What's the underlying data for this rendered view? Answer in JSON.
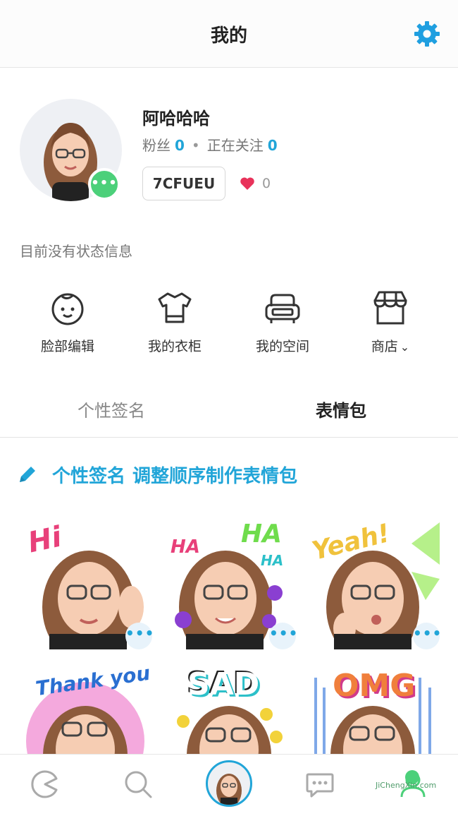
{
  "header": {
    "title": "我的",
    "settings_icon": "gear-icon",
    "accent": "#21a5d8"
  },
  "profile": {
    "name": "阿哈哈哈",
    "followers_label": "粉丝",
    "followers": "0",
    "separator": "•",
    "following_label": "正在关注",
    "following": "0",
    "code": "7CFUEU",
    "likes": "0",
    "badge_dots": "•••",
    "status": "目前没有状态信息"
  },
  "actions": [
    {
      "label": "脸部编辑",
      "icon": "face-icon"
    },
    {
      "label": "我的衣柜",
      "icon": "shirt-icon"
    },
    {
      "label": "我的空间",
      "icon": "sofa-icon"
    },
    {
      "label": "商店",
      "icon": "store-icon",
      "suffix": "⌄"
    }
  ],
  "tabs": [
    {
      "label": "个性签名",
      "active": false
    },
    {
      "label": "表情包",
      "active": true
    }
  ],
  "sticker_bar": {
    "item1": "个性签名",
    "item2": "调整顺序",
    "item3": "制作表情包",
    "icon": "pencil-icon"
  },
  "stickers": [
    {
      "word": "Hi"
    },
    {
      "word": "HA",
      "word2": "HA",
      "word3": "HA"
    },
    {
      "word": "Yeah!"
    },
    {
      "word": "Thank you"
    },
    {
      "word": "SAD"
    },
    {
      "word": "OMG"
    }
  ],
  "more_dots": "•••",
  "bottom_nav": [
    "pacman-icon",
    "search-icon",
    "avatar",
    "chat-icon",
    "profile-icon"
  ],
  "watermark": {
    "line1": "JiChengXin.com"
  }
}
